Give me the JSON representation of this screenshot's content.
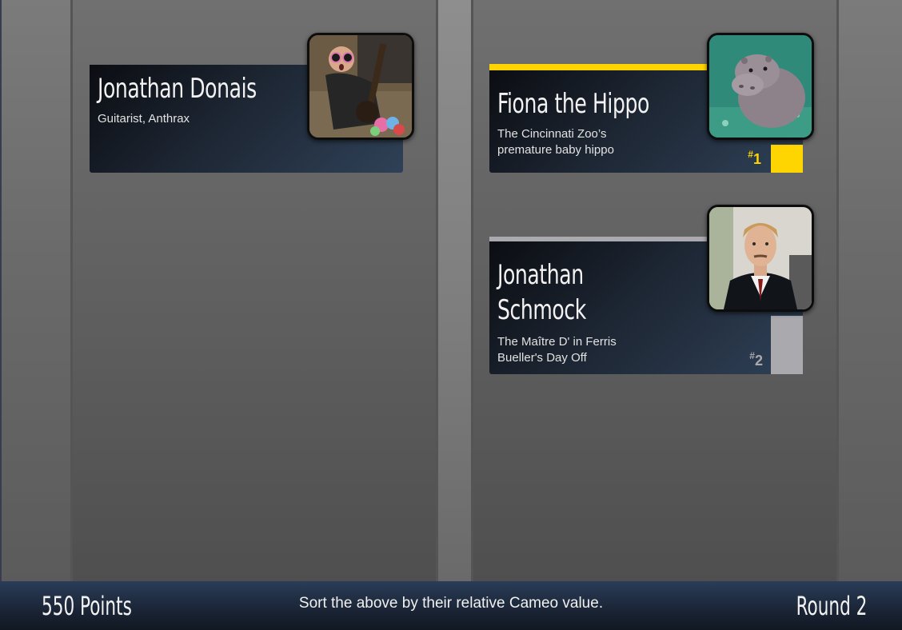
{
  "cards": {
    "left": {
      "name": "Jonathan Donais",
      "description": "Guitarist, Anthrax",
      "photo_icon": "guitarist-photo"
    },
    "right": [
      {
        "name": "Fiona the Hippo",
        "description_line1": "The Cincinnati Zoo’s",
        "description_line2": "premature baby hippo",
        "rank_prefix": "#",
        "rank": "1",
        "accent_color": "#ffd500",
        "photo_icon": "hippo-photo"
      },
      {
        "name_line1": "Jonathan",
        "name_line2": "Schmock",
        "description_line1": "The Maître D' in Ferris",
        "description_line2": "Bueller's Day Off",
        "rank_prefix": "#",
        "rank": "2",
        "accent_color": "#a9a9ae",
        "photo_icon": "maitre-d-photo"
      }
    ]
  },
  "footer": {
    "points": "550 Points",
    "instructions": "Sort the above by their relative Cameo value.",
    "round": "Round 2"
  }
}
